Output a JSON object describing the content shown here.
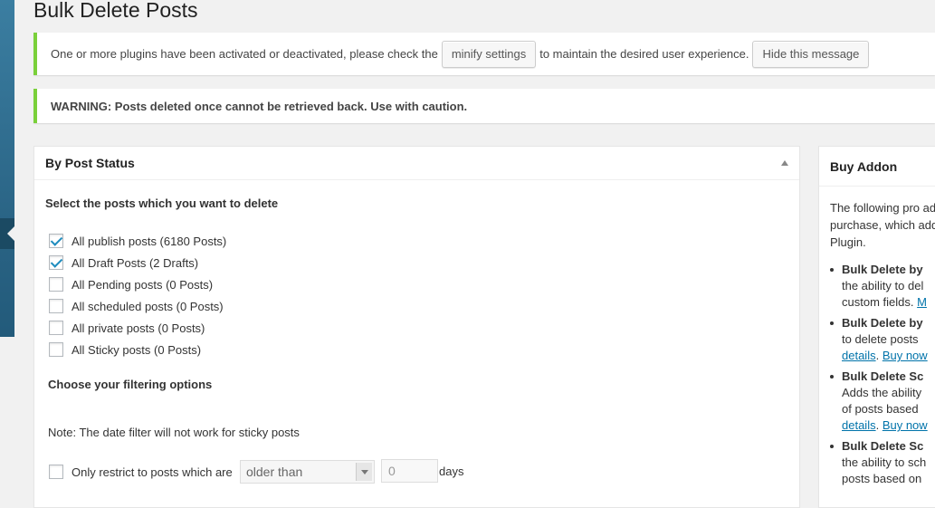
{
  "page": {
    "title": "Bulk Delete Posts"
  },
  "notices": {
    "plugins": {
      "text_before": "One or more plugins have been activated or deactivated, please check the",
      "minify_button": "minify settings",
      "text_after": "to maintain the desired user experience.",
      "hide_button": "Hide this message"
    },
    "warning": "WARNING: Posts deleted once cannot be retrieved back. Use with caution."
  },
  "main_box": {
    "title": "By Post Status",
    "select_label": "Select the posts which you want to delete",
    "options": [
      {
        "label": "All publish posts (6180 Posts)",
        "checked": true
      },
      {
        "label": "All Draft Posts (2 Drafts)",
        "checked": true
      },
      {
        "label": "All Pending posts (0 Posts)",
        "checked": false
      },
      {
        "label": "All scheduled posts (0 Posts)",
        "checked": false
      },
      {
        "label": "All private posts (0 Posts)",
        "checked": false
      },
      {
        "label": "All Sticky posts (0 Posts)",
        "checked": false
      }
    ],
    "filter_heading": "Choose your filtering options",
    "note": "Note: The date filter will not work for sticky posts",
    "restrict_label": "Only restrict to posts which are",
    "restrict_select": "older than",
    "restrict_value": "0",
    "restrict_unit": "days"
  },
  "side_box": {
    "title": "Buy Addon",
    "intro": [
      "The following pro add",
      "purchase, which add",
      "Plugin."
    ],
    "items": [
      {
        "title": "Bulk Delete by",
        "lines": [
          "the ability to del",
          "custom fields."
        ],
        "link_tail": "M"
      },
      {
        "title": "Bulk Delete by",
        "lines": [
          "to delete posts"
        ],
        "details": "details",
        "buy": "Buy now"
      },
      {
        "title": "Bulk Delete Sc",
        "lines": [
          "Adds the ability",
          "of posts based"
        ],
        "details": "details",
        "buy": "Buy now"
      },
      {
        "title": "Bulk Delete Sc",
        "lines": [
          "the ability to sch",
          "posts based on"
        ]
      }
    ]
  },
  "colors": {
    "admin_bar": "#2a6485",
    "notice_border": "#7ad03a",
    "checkbox_check": "#1e8cbe",
    "link": "#0073aa"
  }
}
